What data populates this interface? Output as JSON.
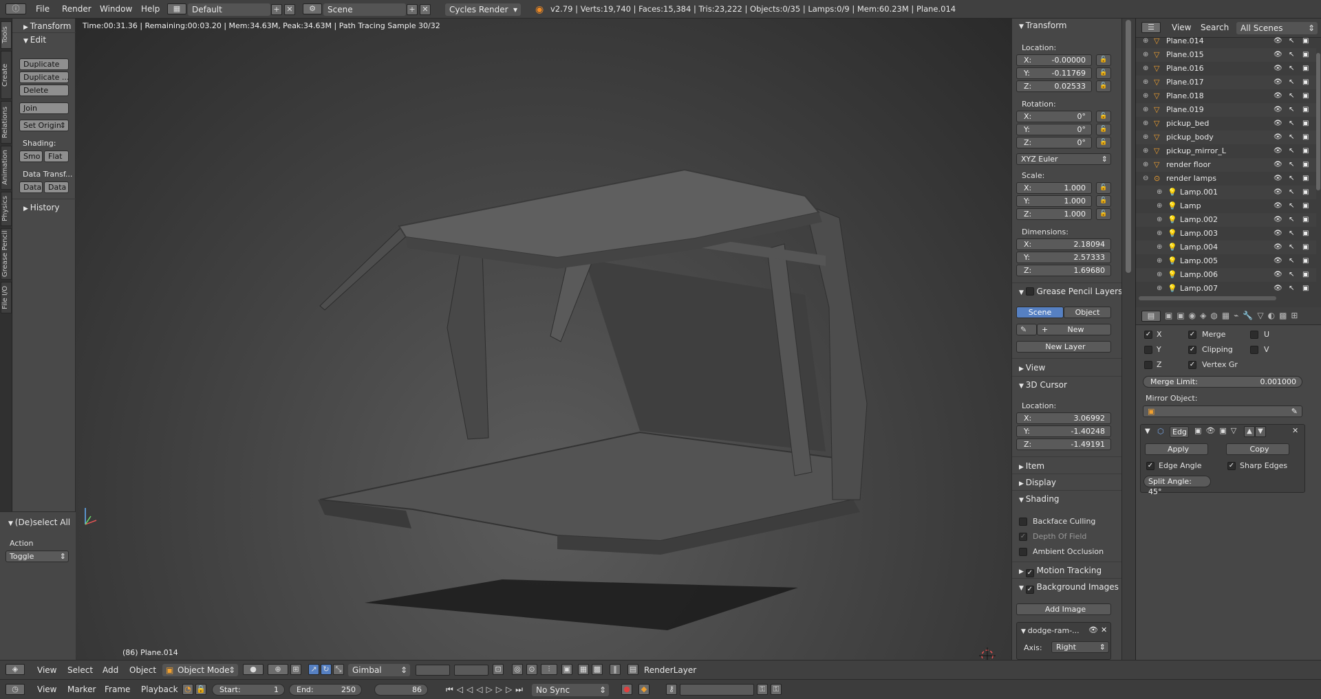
{
  "topbar": {
    "menus": [
      "File",
      "Render",
      "Window",
      "Help"
    ],
    "screen_layout": "Default",
    "scene": "Scene",
    "engine": "Cycles Render",
    "stats": "v2.79 | Verts:19,740 | Faces:15,384 | Tris:23,222 | Objects:0/35 | Lamps:0/9 | Mem:60.23M | Plane.014"
  },
  "left_tabs": [
    "Tools",
    "Create",
    "Relations",
    "Animation",
    "Physics",
    "Grease Pencil",
    "File I/O"
  ],
  "toolshelf": {
    "transform_header": "Transform",
    "edit_header": "Edit",
    "duplicate": "Duplicate",
    "duplicate_linked": "Duplicate ...",
    "delete": "Delete",
    "join": "Join",
    "set_origin": "Set Origin",
    "shading_label": "Shading:",
    "smooth": "Smo",
    "flat": "Flat",
    "data_transfer_label": "Data Transf...",
    "data1": "Data",
    "data2": "Data",
    "history_header": "History"
  },
  "operator_panel": {
    "header": "(De)select All",
    "action_label": "Action",
    "action_value": "Toggle"
  },
  "viewport": {
    "render_status": "Time:00:31.36 | Remaining:00:03.20 | Mem:34.63M, Peak:34.63M | Path Tracing Sample 30/32",
    "object_label": "(86) Plane.014"
  },
  "properties": {
    "transform_header": "Transform",
    "location_label": "Location:",
    "location": {
      "x": "-0.00000",
      "y": "-0.11769",
      "z": "0.02533"
    },
    "rotation_label": "Rotation:",
    "rotation": {
      "x": "0°",
      "y": "0°",
      "z": "0°"
    },
    "rotation_mode": "XYZ Euler",
    "scale_label": "Scale:",
    "scale": {
      "x": "1.000",
      "y": "1.000",
      "z": "1.000"
    },
    "dimensions_label": "Dimensions:",
    "dimensions": {
      "x": "2.18094",
      "y": "2.57333",
      "z": "1.69680"
    },
    "axis_x": "X:",
    "axis_y": "Y:",
    "axis_z": "Z:",
    "grease_pencil_header": "Grease Pencil Layers",
    "scene_tab": "Scene",
    "object_tab": "Object",
    "new_button": "New",
    "new_layer_button": "New Layer",
    "view_header": "View",
    "cursor_header": "3D Cursor",
    "cursor_location_label": "Location:",
    "cursor": {
      "x": "3.06992",
      "y": "-1.40248",
      "z": "-1.49191"
    },
    "item_header": "Item",
    "display_header": "Display",
    "shading_header": "Shading",
    "backface_culling": "Backface Culling",
    "depth_of_field": "Depth Of Field",
    "ambient_occlusion": "Ambient Occlusion",
    "motion_tracking_header": "Motion Tracking",
    "background_images_header": "Background Images",
    "add_image_button": "Add Image",
    "bg_image_name": "dodge-ram-...",
    "axis_label": "Axis:",
    "axis_value": "Right"
  },
  "outliner": {
    "view_menu": "View",
    "search_menu": "Search",
    "scenes_dropdown": "All Scenes",
    "items": [
      {
        "name": "Plane.014",
        "type": "mesh"
      },
      {
        "name": "Plane.015",
        "type": "mesh"
      },
      {
        "name": "Plane.016",
        "type": "mesh"
      },
      {
        "name": "Plane.017",
        "type": "mesh"
      },
      {
        "name": "Plane.018",
        "type": "mesh"
      },
      {
        "name": "Plane.019",
        "type": "mesh"
      },
      {
        "name": "pickup_bed",
        "type": "mesh"
      },
      {
        "name": "pickup_body",
        "type": "mesh"
      },
      {
        "name": "pickup_mirror_L",
        "type": "mesh"
      },
      {
        "name": "render floor",
        "type": "mesh"
      },
      {
        "name": "render lamps",
        "type": "empty"
      },
      {
        "name": "Lamp.001",
        "type": "lamp"
      },
      {
        "name": "Lamp",
        "type": "lamp"
      },
      {
        "name": "Lamp.002",
        "type": "lamp"
      },
      {
        "name": "Lamp.003",
        "type": "lamp"
      },
      {
        "name": "Lamp.004",
        "type": "lamp"
      },
      {
        "name": "Lamp.005",
        "type": "lamp"
      },
      {
        "name": "Lamp.006",
        "type": "lamp"
      },
      {
        "name": "Lamp.007",
        "type": "lamp"
      }
    ]
  },
  "modifiers": {
    "mirror": {
      "axis_x": "X",
      "axis_y": "Y",
      "axis_z": "Z",
      "merge": "Merge",
      "clipping": "Clipping",
      "vertex_groups": "Vertex Gr",
      "u": "U",
      "v": "V",
      "merge_limit_label": "Merge Limit:",
      "merge_limit_value": "0.001000",
      "mirror_object_label": "Mirror Object:"
    },
    "edge_split": {
      "name": "Edg",
      "apply": "Apply",
      "copy": "Copy",
      "edge_angle": "Edge Angle",
      "sharp_edges": "Sharp Edges",
      "split_angle": "Split Angle: 45°"
    }
  },
  "view3d_header": {
    "menus": [
      "View",
      "Select",
      "Add",
      "Object"
    ],
    "mode": "Object Mode",
    "orientation": "Gimbal",
    "render_layer": "RenderLayer"
  },
  "timeline": {
    "menus": [
      "View",
      "Marker",
      "Frame",
      "Playback"
    ],
    "start_label": "Start:",
    "start_value": "1",
    "end_label": "End:",
    "end_value": "250",
    "current_frame": "86",
    "sync": "No Sync"
  }
}
